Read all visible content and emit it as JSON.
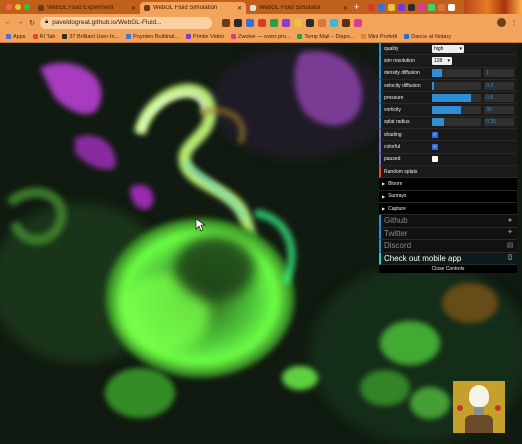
{
  "browser": {
    "tabs": [
      {
        "title": "WebGL Fluid Experiment",
        "active": false
      },
      {
        "title": "WebGL Fluid Simulation",
        "active": true
      },
      {
        "title": "WebGL Fluid Simulator",
        "active": false
      }
    ],
    "address": "paveldogreat.github.io/WebGL-Fluid...",
    "bookmarks": [
      {
        "label": "Apps",
        "color": "#4a6fd8"
      },
      {
        "label": "RI Tab",
        "color": "#e4472c"
      },
      {
        "label": "37 Brilliant User-In...",
        "color": "#2d2d2d"
      },
      {
        "label": "Poynteo Buildrial...",
        "color": "#3a7bd5"
      },
      {
        "label": "Printie Video",
        "color": "#7b3ad5"
      },
      {
        "label": "Zwolve — overr.pro...",
        "color": "#d53a8c"
      },
      {
        "label": "Temp Mail – Dispo...",
        "color": "#2d9d48"
      },
      {
        "label": "Mini Profetti",
        "color": "#d58a2d"
      },
      {
        "label": "Dance at Notary",
        "color": "#2d6ad5"
      }
    ]
  },
  "controls": {
    "quality": {
      "label": "quality",
      "value": "high"
    },
    "sim_resolution": {
      "label": "sim resolution",
      "value": "128"
    },
    "sliders": [
      {
        "label": "density diffusion",
        "value": "1",
        "level": 0.2
      },
      {
        "label": "velocity diffusion",
        "value": "0.2",
        "level": 0.05
      },
      {
        "label": "pressure",
        "value": "0.8",
        "level": 0.8
      },
      {
        "label": "vorticity",
        "value": "30",
        "level": 0.6
      },
      {
        "label": "splat radius",
        "value": "0.25",
        "level": 0.25
      }
    ],
    "checks": [
      {
        "label": "shading",
        "checked": true
      },
      {
        "label": "colorful",
        "checked": true
      },
      {
        "label": "paused",
        "checked": false
      }
    ],
    "random_splats": "Random splats",
    "folders": [
      "Bloom",
      "Sunrays",
      "Capture"
    ],
    "links": [
      {
        "label": "Github",
        "icon": "github-icon",
        "glyph": "●"
      },
      {
        "label": "Twitter",
        "icon": "twitter-icon",
        "glyph": "✦"
      },
      {
        "label": "Discord",
        "icon": "discord-icon",
        "glyph": "▤"
      },
      {
        "label": "Check out mobile app",
        "icon": "mobile-phone-icon",
        "glyph": "▯"
      }
    ],
    "close": "Close Controls"
  },
  "colors": {
    "tabstrip": "#c0601a",
    "toolbar": "#f3a45c",
    "panel": "#1a1a1a",
    "slider_fill": "#2f8fd5",
    "fluid_green": "#5cff3a",
    "fluid_magenta": "#b040c8"
  }
}
